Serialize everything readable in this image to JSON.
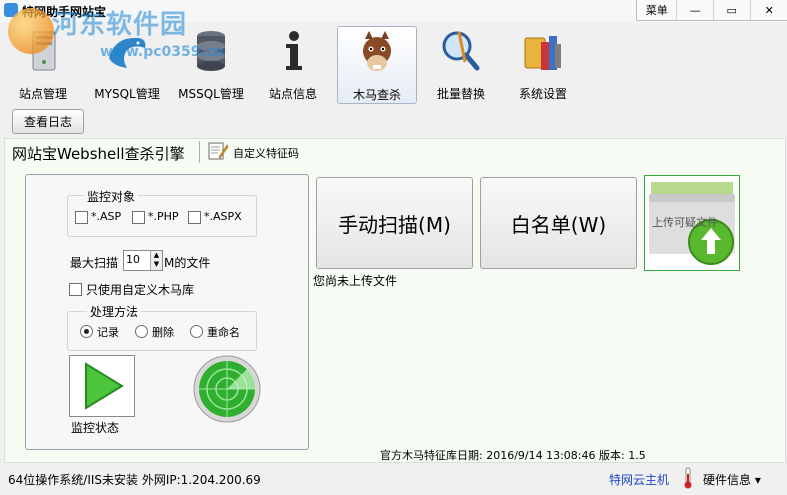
{
  "window": {
    "title": "特网助手网站宝",
    "menu_label": "菜单",
    "min_glyph": "—",
    "max_glyph": "▭",
    "close_glyph": "✕"
  },
  "watermark": {
    "site_name": "河东软件园",
    "site_url": "www.pc0359.cn"
  },
  "toolbar": {
    "items": [
      {
        "label": "站点管理",
        "icon": "server-icon"
      },
      {
        "label": "MYSQL管理",
        "icon": "dolphin-icon"
      },
      {
        "label": "MSSQL管理",
        "icon": "database-icon"
      },
      {
        "label": "站点信息",
        "icon": "info-icon"
      },
      {
        "label": "木马查杀",
        "icon": "horse-icon"
      },
      {
        "label": "批量替换",
        "icon": "magnifier-icon"
      },
      {
        "label": "系统设置",
        "icon": "settings-tools-icon"
      }
    ],
    "active": "木马查杀",
    "view_log_label": "查看日志"
  },
  "engine": {
    "title": "网站宝Webshell查杀引擎",
    "custom_signature_label": "自定义特征码"
  },
  "monitor": {
    "targets_title": "监控对象",
    "targets": [
      {
        "label": "*.ASP",
        "checked": false
      },
      {
        "label": "*.PHP",
        "checked": false
      },
      {
        "label": "*.ASPX",
        "checked": false
      }
    ],
    "max_scan_label": "最大扫描",
    "max_scan_value": "10",
    "max_scan_unit": "M的文件",
    "custom_lib_label": "只使用自定义木马库",
    "custom_lib_checked": false,
    "method_title": "处理方法",
    "methods": [
      {
        "label": "记录",
        "selected": true
      },
      {
        "label": "删除",
        "selected": false
      },
      {
        "label": "重命名",
        "selected": false
      }
    ],
    "status_label": "监控状态"
  },
  "actions": {
    "manual_scan_label": "手动扫描(M)",
    "whitelist_label": "白名单(W)",
    "upload_label": "上传可疑文件",
    "upload_status": "您尚未上传文件"
  },
  "signature": {
    "date_text": "官方木马特征库日期: 2016/9/14 13:08:46 版本: 1.5"
  },
  "statusbar": {
    "system_info": "64位操作系统/IIS未安装  外网IP:1.204.200.69",
    "cloud_link": "特网云主机",
    "hardware_label": "硬件信息 ▾"
  }
}
